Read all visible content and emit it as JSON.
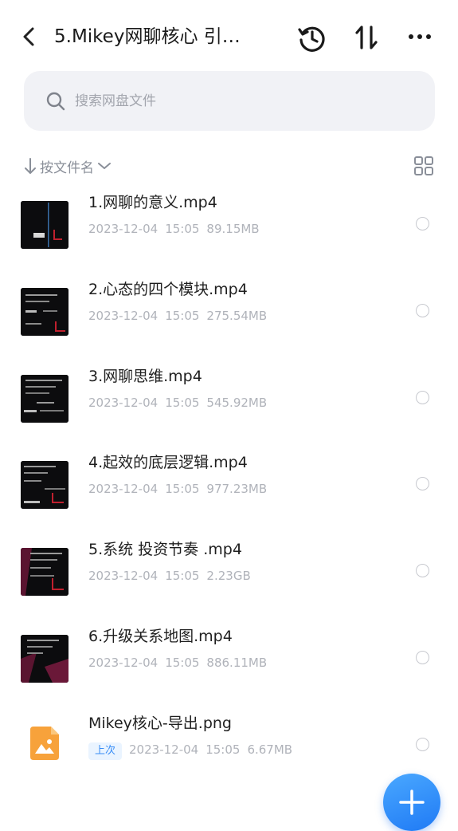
{
  "header": {
    "title": "5.Mikey网聊核心 引…",
    "icons": [
      "back-chevron-icon",
      "history-icon",
      "sort-arrows-icon",
      "more-icon"
    ]
  },
  "search": {
    "placeholder": "搜索网盘文件"
  },
  "sort": {
    "label": "按文件名"
  },
  "files": [
    {
      "name": "1.网聊的意义.mp4",
      "date": "2023-12-04",
      "time": "15:05",
      "size": "89.15MB",
      "kind": "video"
    },
    {
      "name": "2.心态的四个模块.mp4",
      "date": "2023-12-04",
      "time": "15:05",
      "size": "275.54MB",
      "kind": "video"
    },
    {
      "name": "3.网聊思维.mp4",
      "date": "2023-12-04",
      "time": "15:05",
      "size": "545.92MB",
      "kind": "video"
    },
    {
      "name": "4.起效的底层逻辑.mp4",
      "date": "2023-12-04",
      "time": "15:05",
      "size": "977.23MB",
      "kind": "video"
    },
    {
      "name": "5.系统 投资节奏 .mp4",
      "date": "2023-12-04",
      "time": "15:05",
      "size": "2.23GB",
      "kind": "video"
    },
    {
      "name": "6.升级关系地图.mp4",
      "date": "2023-12-04",
      "time": "15:05",
      "size": "886.11MB",
      "kind": "video"
    },
    {
      "name": "Mikey核心-导出.png",
      "badge": "上次",
      "date": "2023-12-04",
      "time": "15:05",
      "size": "6.67MB",
      "kind": "image"
    }
  ],
  "colors": {
    "accent": "#2f86f6",
    "image_icon": "#f7a23b",
    "text_meta": "#b0b3ba"
  }
}
